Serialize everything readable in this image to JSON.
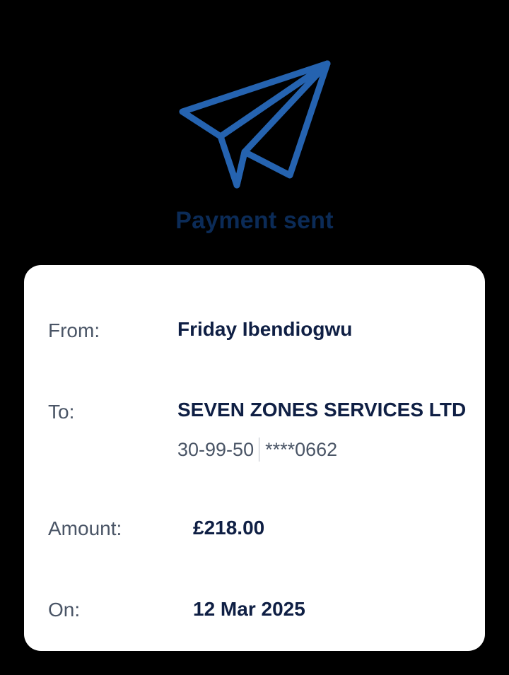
{
  "header": {
    "icon": "paper-plane-icon",
    "title": "Payment sent"
  },
  "details": {
    "from_label": "From:",
    "from_value": "Friday Ibendiogwu",
    "to_label": "To:",
    "to_name": "SEVEN ZONES SERVICES LTD",
    "to_sort_code": "30-99-50",
    "to_account": "****0662",
    "amount_label": "Amount:",
    "amount_value": "£218.00",
    "date_label": "On:",
    "date_value": "12 Mar 2025"
  },
  "colors": {
    "background": "#000000",
    "accent": "#2563b0",
    "title": "#0b2b57",
    "card": "#ffffff",
    "value_text": "#0f1f44",
    "label_text": "#4a5566"
  }
}
